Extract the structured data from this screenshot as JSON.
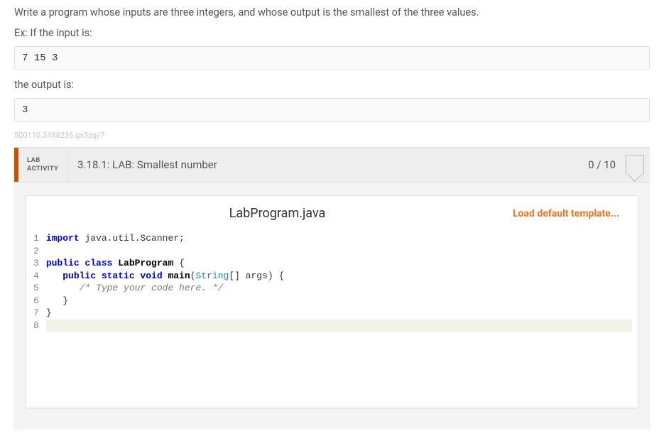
{
  "problem": {
    "description": "Write a program whose inputs are three integers, and whose output is the smallest of the three values.",
    "example_label": "Ex: If the input is:",
    "example_input": "7 15 3",
    "output_label": "the output is:",
    "example_output": "3"
  },
  "watermark": "500110.3488236.qx3zqy7",
  "activity": {
    "label_line1": "LAB",
    "label_line2": "ACTIVITY",
    "title": "3.18.1: LAB: Smallest number",
    "score": "0 / 10"
  },
  "editor": {
    "filename": "LabProgram.java",
    "load_template_label": "Load default template...",
    "gutter": [
      "1",
      "2",
      "3",
      "4",
      "5",
      "6",
      "7",
      "8"
    ],
    "code": {
      "tokens": [
        [
          {
            "t": "import ",
            "c": "kw"
          },
          {
            "t": "java.util.Scanner;",
            "c": ""
          }
        ],
        [
          {
            "t": "",
            "c": ""
          }
        ],
        [
          {
            "t": "public class ",
            "c": "kw"
          },
          {
            "t": "LabProgram",
            "c": "cls"
          },
          {
            "t": " {",
            "c": ""
          }
        ],
        [
          {
            "t": "   ",
            "c": ""
          },
          {
            "t": "public static void ",
            "c": "kw"
          },
          {
            "t": "main",
            "c": "mtd"
          },
          {
            "t": "(",
            "c": ""
          },
          {
            "t": "String",
            "c": "type"
          },
          {
            "t": "[] args) {",
            "c": ""
          }
        ],
        [
          {
            "t": "      ",
            "c": ""
          },
          {
            "t": "/* Type your code here. */",
            "c": "cmt"
          }
        ],
        [
          {
            "t": "   }",
            "c": ""
          }
        ],
        [
          {
            "t": "}",
            "c": ""
          }
        ],
        [
          {
            "t": "",
            "c": ""
          }
        ]
      ]
    }
  }
}
